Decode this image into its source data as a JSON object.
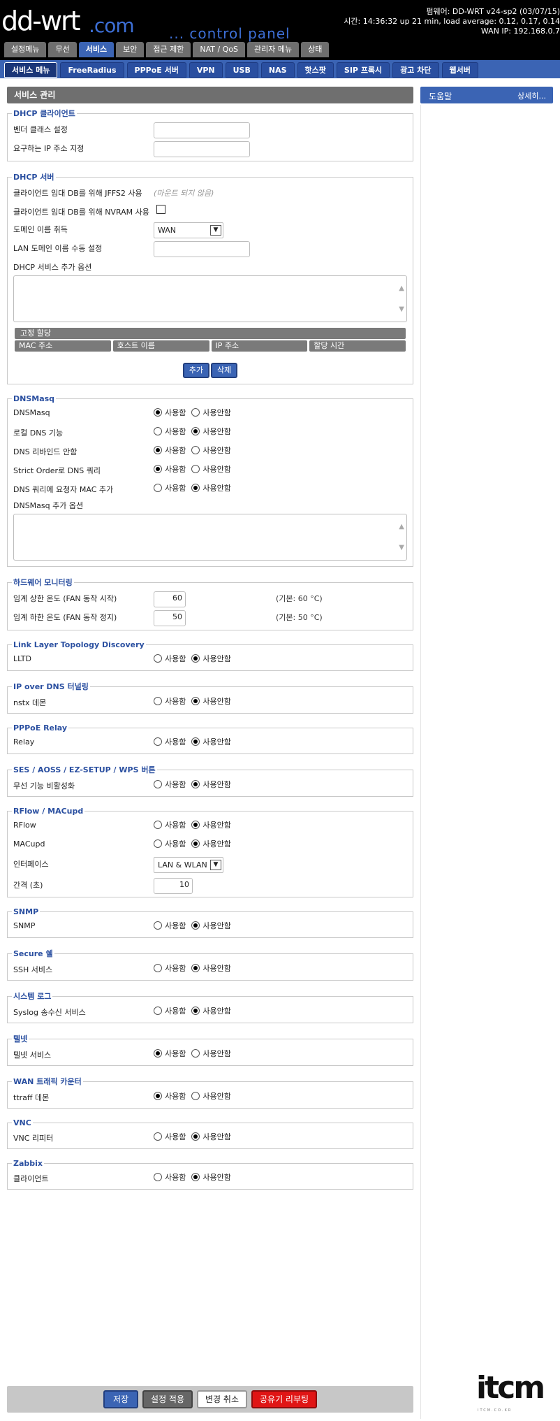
{
  "header": {
    "logo_main": "dd-wrt",
    "logo_com": ".com",
    "logo_sub": "... control panel",
    "firmware": "펌웨어: DD-WRT v24-sp2 (03/07/15)",
    "time": "시간: 14:36:32 up 21 min, load average: 0.12, 0.17, 0.14",
    "wan_ip": "WAN IP: 192.168.0.7"
  },
  "main_tabs": [
    "설정메뉴",
    "무선",
    "서비스",
    "보안",
    "접근 제한",
    "NAT / QoS",
    "관리자 메뉴",
    "상태"
  ],
  "sub_tabs": [
    "서비스 메뉴",
    "FreeRadius",
    "PPPoE 서버",
    "VPN",
    "USB",
    "NAS",
    "핫스팟",
    "SIP 프록시",
    "광고 차단",
    "웹서버"
  ],
  "page_title": "서비스 관리",
  "radio_labels": {
    "on": "사용함",
    "off": "사용안함"
  },
  "sections": {
    "dhcp_client": {
      "legend": "DHCP 클라이언트",
      "vendor_class": "벤더 클래스 설정",
      "request_ip": "요구하는 IP 주소 지정"
    },
    "dhcp_server": {
      "legend": "DHCP 서버",
      "jffs2_label": "클라이언트 임대 DB를 위해 JFFS2 사용",
      "jffs2_note": "(마운트 되지 않음)",
      "nvram_label": "클라이언트 임대 DB를 위해 NVRAM 사용",
      "domain_label": "도메인 이름 취득",
      "domain_value": "WAN",
      "lan_domain_label": "LAN 도메인 이름 수동 설정",
      "options_label": "DHCP 서비스 추가 옵션",
      "static_leases": "고정 할당",
      "columns": [
        "MAC 주소",
        "호스트 이름",
        "IP 주소",
        "할당 시간"
      ],
      "add_button": "추가",
      "delete_button": "삭제"
    },
    "dnsmasq": {
      "legend": "DNSMasq",
      "rows": [
        {
          "label": "DNSMasq",
          "enabled": true
        },
        {
          "label": "로컬 DNS 기능",
          "enabled": false
        },
        {
          "label": "DNS 리바인드 안함",
          "enabled": true
        },
        {
          "label": "Strict Order로 DNS 쿼리",
          "enabled": true
        },
        {
          "label": "DNS 쿼리에 요청자 MAC 추가",
          "enabled": false
        }
      ],
      "options_label": "DNSMasq 추가 옵션"
    },
    "hw_monitor": {
      "legend": "하드웨어 모니터링",
      "upper_label": "임계 상한 온도 (FAN 동작 시작)",
      "upper_value": "60",
      "upper_hint": "(기본: 60 °C)",
      "lower_label": "임계 하한 온도 (FAN 동작 정지)",
      "lower_value": "50",
      "lower_hint": "(기본: 50 °C)"
    },
    "lltd": {
      "legend": "Link Layer Topology Discovery",
      "label": "LLTD",
      "enabled": false
    },
    "iodine": {
      "legend": "IP over DNS 터널링",
      "label": "nstx 데몬",
      "enabled": false
    },
    "pppoe_relay": {
      "legend": "PPPoE Relay",
      "label": "Relay",
      "enabled": false
    },
    "ses": {
      "legend": "SES / AOSS / EZ-SETUP / WPS 버튼",
      "label": "무선 기능 비활성화",
      "enabled": false
    },
    "rflow": {
      "legend": "RFlow / MACupd",
      "rflow_label": "RFlow",
      "rflow_enabled": false,
      "macupd_label": "MACupd",
      "macupd_enabled": false,
      "iface_label": "인터페이스",
      "iface_value": "LAN & WLAN",
      "interval_label": "간격 (초)",
      "interval_value": "10"
    },
    "snmp": {
      "legend": "SNMP",
      "label": "SNMP",
      "enabled": false
    },
    "ssh": {
      "legend": "Secure 쉘",
      "label": "SSH 서비스",
      "enabled": false
    },
    "syslog": {
      "legend": "시스템 로그",
      "label": "Syslog 송수신 서비스",
      "enabled": false
    },
    "telnet": {
      "legend": "텔넷",
      "label": "텔넷 서비스",
      "enabled": true
    },
    "ttraff": {
      "legend": "WAN 트래픽 카운터",
      "label": "ttraff 데몬",
      "enabled": true
    },
    "vnc": {
      "legend": "VNC",
      "label": "VNC 리피터",
      "enabled": false
    },
    "zabbix": {
      "legend": "Zabbix",
      "label": "클라이언트",
      "enabled": false
    }
  },
  "help": {
    "title": "도움말",
    "more": "상세히..."
  },
  "footer": {
    "save": "저장",
    "apply": "설정 적용",
    "cancel": "변경 취소",
    "reboot": "공유기 리부팅"
  },
  "watermark": {
    "mark": "itcm",
    "sub": "ITCM.CO.KR"
  }
}
